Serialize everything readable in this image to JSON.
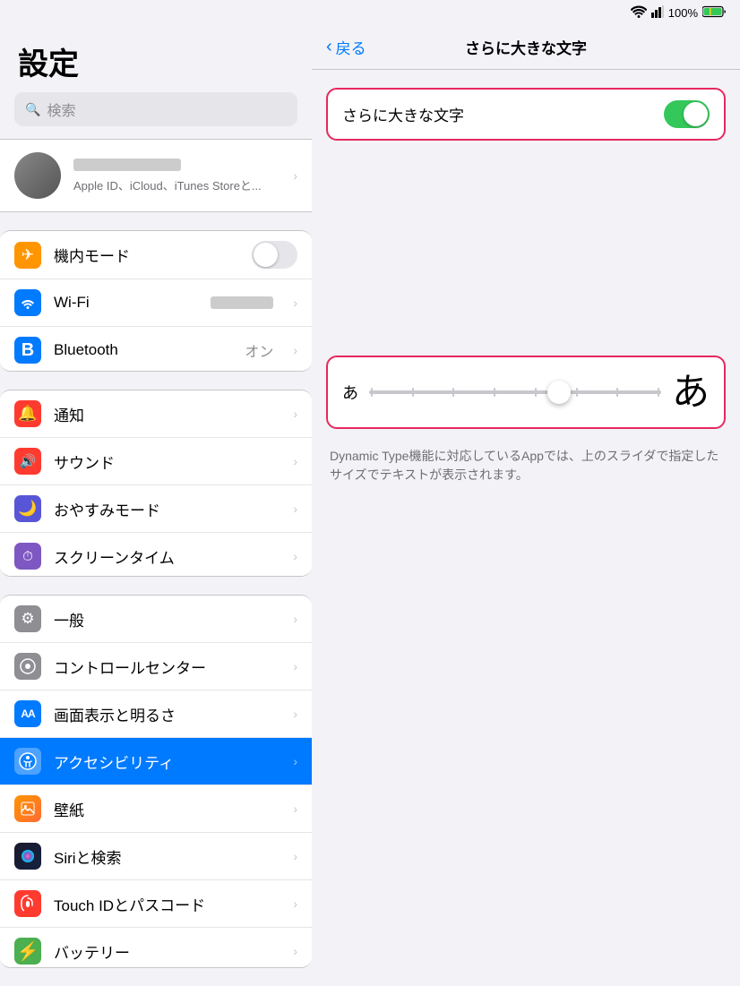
{
  "statusBar": {
    "wifi": "wifi",
    "battery": "100%",
    "batteryIcon": "🔋"
  },
  "sidebar": {
    "title": "設定",
    "searchPlaceholder": "検索",
    "account": {
      "description": "Apple ID、iCloud、iTunes Storeと..."
    },
    "sections": [
      {
        "items": [
          {
            "id": "airplane",
            "label": "機内モード",
            "icon": "✈",
            "iconBg": "#ff9500",
            "type": "toggle",
            "toggleOn": false
          },
          {
            "id": "wifi",
            "label": "Wi-Fi",
            "icon": "📶",
            "iconBg": "#007aff",
            "type": "value",
            "value": "██████"
          },
          {
            "id": "bluetooth",
            "label": "Bluetooth",
            "icon": "⊞",
            "iconBg": "#007aff",
            "type": "value",
            "value": "オン"
          }
        ]
      },
      {
        "items": [
          {
            "id": "notifications",
            "label": "通知",
            "icon": "🔔",
            "iconBg": "#ff3b30",
            "type": "chevron"
          },
          {
            "id": "sounds",
            "label": "サウンド",
            "icon": "🔊",
            "iconBg": "#ff3b30",
            "type": "chevron"
          },
          {
            "id": "donotdisturb",
            "label": "おやすみモード",
            "icon": "🌙",
            "iconBg": "#5856d6",
            "type": "chevron"
          },
          {
            "id": "screentime",
            "label": "スクリーンタイム",
            "icon": "⏱",
            "iconBg": "#7e57c2",
            "type": "chevron"
          }
        ]
      },
      {
        "items": [
          {
            "id": "general",
            "label": "一般",
            "icon": "⚙",
            "iconBg": "#8e8e93",
            "type": "chevron"
          },
          {
            "id": "controlcenter",
            "label": "コントロールセンター",
            "icon": "◉",
            "iconBg": "#8e8e93",
            "type": "chevron"
          },
          {
            "id": "display",
            "label": "画面表示と明るさ",
            "icon": "AA",
            "iconBg": "#007aff",
            "type": "chevron"
          },
          {
            "id": "accessibility",
            "label": "アクセシビリティ",
            "icon": "☺",
            "iconBg": "#007aff",
            "type": "chevron",
            "active": true
          },
          {
            "id": "wallpaper",
            "label": "壁紙",
            "icon": "❋",
            "iconBg": "#ff9500",
            "type": "chevron"
          },
          {
            "id": "siri",
            "label": "Siriと検索",
            "icon": "◎",
            "iconBg": "#000",
            "type": "chevron"
          },
          {
            "id": "touchid",
            "label": "Touch IDとパスコード",
            "icon": "👆",
            "iconBg": "#ff3b30",
            "type": "chevron"
          },
          {
            "id": "battery",
            "label": "バッテリー",
            "icon": "⚡",
            "iconBg": "#4caf50",
            "type": "chevron"
          }
        ]
      }
    ]
  },
  "rightPanel": {
    "backLabel": "戻る",
    "title": "さらに大きな文字",
    "toggleRow": {
      "label": "さらに大きな文字",
      "on": true
    },
    "sliderSmallLabel": "あ",
    "sliderLargeLabel": "あ",
    "description": "Dynamic Type機能に対応しているAppでは、上のスライダで指定したサイズでテキストが表示されます。",
    "sliderValue": 65
  }
}
